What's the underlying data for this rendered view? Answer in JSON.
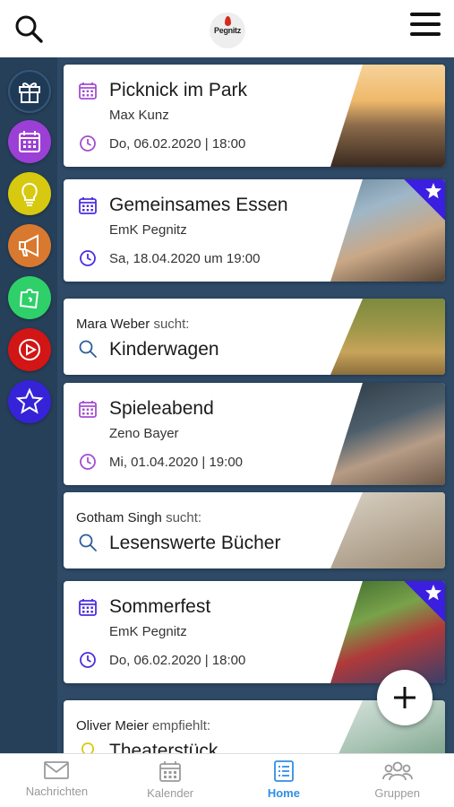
{
  "header": {
    "logo_text": "Pegnitz"
  },
  "colors": {
    "calendar_purple": "#a24fd0",
    "calendar_blue": "#4b2ee0",
    "search_blue": "#2b5d9a",
    "active_tab": "#2f8ee6",
    "rail_bg": "#26405a",
    "page_bg": "#2e4a66"
  },
  "categories": [
    {
      "icon": "gift-icon",
      "color": "#1f3a56"
    },
    {
      "icon": "calendar-icon",
      "color": "#9c3fd6"
    },
    {
      "icon": "lightbulb-icon",
      "color": "#d7c90f"
    },
    {
      "icon": "megaphone-icon",
      "color": "#d9792f"
    },
    {
      "icon": "puzzle-icon",
      "color": "#2fcf6a"
    },
    {
      "icon": "play-icon",
      "color": "#d21515"
    },
    {
      "icon": "star-icon",
      "color": "#3623d8"
    }
  ],
  "cards": [
    {
      "type": "event",
      "title": "Picknick im Park",
      "subtitle": "Max Kunz",
      "date": "Do, 06.02.2020 | 18:00",
      "featured": false
    },
    {
      "type": "event",
      "title": "Gemeinsames Essen",
      "subtitle": "EmK Pegnitz",
      "date": "Sa, 18.04.2020 um 19:00",
      "featured": true
    },
    {
      "type": "search",
      "person": "Mara Weber",
      "verb": "sucht:",
      "title": "Kinderwagen"
    },
    {
      "type": "event",
      "title": "Spieleabend",
      "subtitle": "Zeno Bayer",
      "date": "Mi, 01.04.2020 | 19:00",
      "featured": false
    },
    {
      "type": "search",
      "person": "Gotham Singh",
      "verb": "sucht:",
      "title": "Lesenswerte Bücher"
    },
    {
      "type": "event",
      "title": "Sommerfest",
      "subtitle": "EmK Pegnitz",
      "date": "Do, 06.02.2020 | 18:00",
      "featured": true
    },
    {
      "type": "recommend",
      "person": "Oliver Meier",
      "verb": "empfiehlt:",
      "title": "Theaterstück"
    }
  ],
  "bottom_nav": [
    {
      "label": "Nachrichten",
      "icon": "mail-icon",
      "active": false
    },
    {
      "label": "Kalender",
      "icon": "calendar-icon",
      "active": false
    },
    {
      "label": "Home",
      "icon": "list-icon",
      "active": true
    },
    {
      "label": "Gruppen",
      "icon": "group-icon",
      "active": false
    }
  ]
}
